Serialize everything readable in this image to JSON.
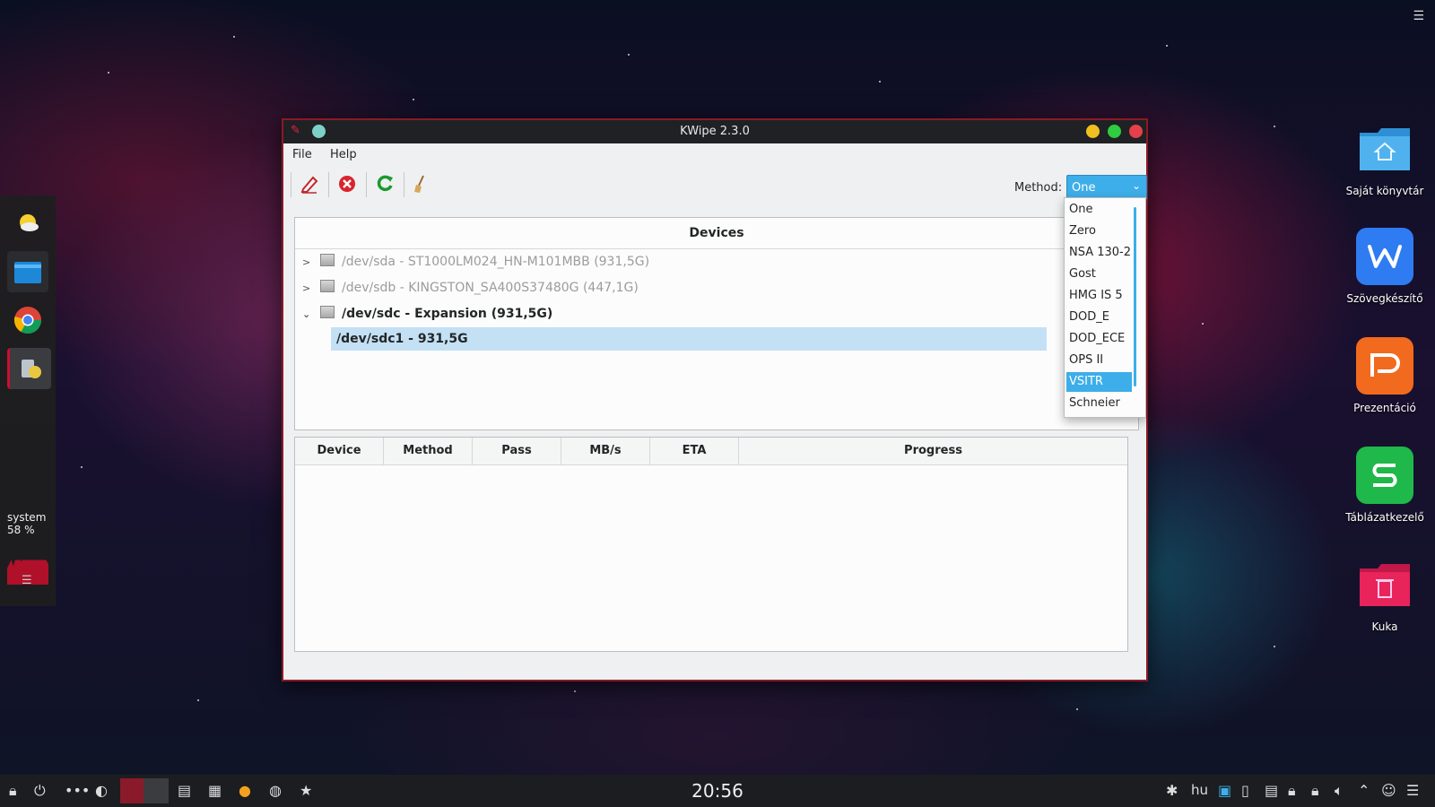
{
  "desktop": {
    "icons": [
      {
        "label": "Saját könyvtár",
        "icon": "home-folder-icon",
        "color": "#3aa0e0"
      },
      {
        "label": "Szövegkészítő",
        "icon": "wps-writer-icon",
        "color": "#2f7bf2"
      },
      {
        "label": "Prezentáció",
        "icon": "wps-presentation-icon",
        "color": "#f26a1e"
      },
      {
        "label": "Táblázatkezelő",
        "icon": "wps-spreadsheet-icon",
        "color": "#1fb84a"
      },
      {
        "label": "Kuka",
        "icon": "trash-folder-icon",
        "color": "#e8245a"
      }
    ]
  },
  "dock": {
    "items": [
      "weather-icon",
      "file-manager-icon",
      "chrome-icon",
      "kwipe-app-icon"
    ],
    "sysmon_label": "system",
    "sysmon_value": "58 %"
  },
  "window": {
    "title": "KWipe 2.3.0",
    "menu": [
      "File",
      "Help"
    ],
    "toolbar": [
      "wipe-icon",
      "cancel-icon",
      "refresh-icon",
      "clean-broom-icon"
    ],
    "method_label": "Method:",
    "method_value": "One",
    "devices_header": "Devices",
    "devices": [
      {
        "label": "/dev/sda - ST1000LM024_HN-M101MBB (931,5G)",
        "expanded": false,
        "disabled": true
      },
      {
        "label": "/dev/sdb - KINGSTON_SA400S37480G (447,1G)",
        "expanded": false,
        "disabled": true
      },
      {
        "label": "/dev/sdc - Expansion (931,5G)",
        "expanded": true,
        "disabled": false
      },
      {
        "label": "/dev/sdc1 - 931,5G",
        "child": true,
        "selected": true
      }
    ],
    "jobs_columns": [
      "Device",
      "Method",
      "Pass",
      "MB/s",
      "ETA",
      "Progress"
    ]
  },
  "dropdown": {
    "options": [
      "One",
      "Zero",
      "NSA 130-2",
      "Gost",
      "HMG IS 5",
      "DOD_E",
      "DOD_ECE",
      "OPS II",
      "VSITR",
      "Schneier"
    ],
    "highlighted": "VSITR"
  },
  "taskbar": {
    "clock": "20:56",
    "keyboard_layout": "hu"
  },
  "colors": {
    "accent": "#3daee9",
    "window_border": "#8a1a26",
    "titlebar": "#1f2124"
  }
}
